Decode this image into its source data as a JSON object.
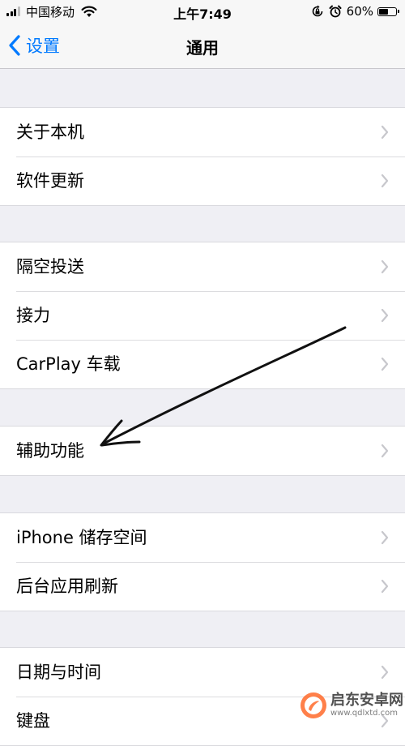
{
  "status_bar": {
    "carrier": "中国移动",
    "time": "上午7:49",
    "battery_percent": "60%",
    "battery_level": 0.6,
    "icons": [
      "signal-icon",
      "wifi-icon",
      "orientation-lock-icon",
      "alarm-icon",
      "battery-icon"
    ]
  },
  "nav": {
    "back_label": "设置",
    "title": "通用",
    "accent_color": "#007aff"
  },
  "groups": [
    {
      "items": [
        "关于本机",
        "软件更新"
      ]
    },
    {
      "items": [
        "隔空投送",
        "接力",
        "CarPlay 车载"
      ]
    },
    {
      "items": [
        "辅助功能"
      ]
    },
    {
      "items": [
        "iPhone 储存空间",
        "后台应用刷新"
      ]
    },
    {
      "items": [
        "日期与时间",
        "键盘"
      ]
    }
  ],
  "annotation": {
    "type": "hand-drawn-arrow",
    "points_to": "辅助功能"
  },
  "watermark": {
    "name": "启东安卓网",
    "url": "www.qdlxtd.com"
  }
}
